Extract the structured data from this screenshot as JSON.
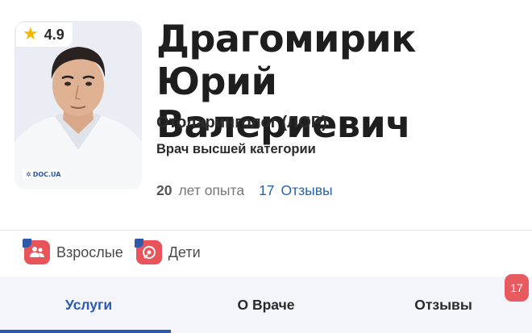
{
  "doctor": {
    "name": "Драгомирик Юрий Валериевич",
    "rating": "4.9",
    "watermark": "DOC.UA",
    "specialty": "Отоларинголог (ЛОР)",
    "category": "Врач высшей категории"
  },
  "stats": {
    "experience_years": "20",
    "experience_label": "лет опыта",
    "reviews_count": "17",
    "reviews_label": "Отзывы"
  },
  "audience": [
    {
      "label": "Взрослые",
      "icon": "adults-icon"
    },
    {
      "label": "Дети",
      "icon": "children-icon"
    }
  ],
  "tabs": {
    "items": [
      {
        "label": "Услуги",
        "active": true
      },
      {
        "label": "О Враче",
        "active": false
      },
      {
        "label": "Отзывы",
        "active": false
      }
    ],
    "reviews_badge": "17"
  },
  "colors": {
    "accent_blue": "#2a5bb0",
    "badge_red": "#e75a5f",
    "star_yellow": "#f5b800"
  }
}
